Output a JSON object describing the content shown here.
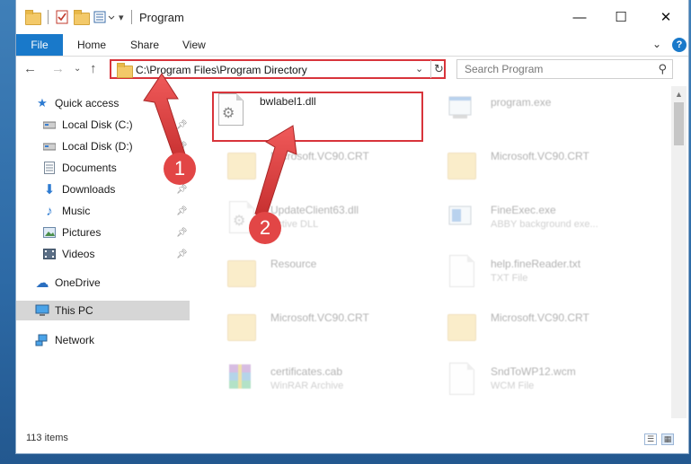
{
  "window": {
    "title": "Program",
    "minimize_glyph": "—",
    "maximize_glyph": "☐",
    "close_glyph": "✕"
  },
  "ribbon": {
    "tabs": [
      "File",
      "Home",
      "Share",
      "View"
    ],
    "help_glyph": "?",
    "expand_glyph": "⌄"
  },
  "address": {
    "path": "C:\\Program Files\\Program Directory",
    "search_placeholder": "Search Program"
  },
  "nav_pane": {
    "items": [
      {
        "label": "Quick access",
        "icon": "star-icon",
        "pinned": false
      },
      {
        "label": "Local Disk (C:)",
        "icon": "drive-icon",
        "pinned": true
      },
      {
        "label": "Local Disk (D:)",
        "icon": "drive-icon",
        "pinned": true
      },
      {
        "label": "Documents",
        "icon": "documents-icon",
        "pinned": true
      },
      {
        "label": "Downloads",
        "icon": "download-icon",
        "pinned": true
      },
      {
        "label": "Music",
        "icon": "music-icon",
        "pinned": true
      },
      {
        "label": "Pictures",
        "icon": "pictures-icon",
        "pinned": true
      },
      {
        "label": "Videos",
        "icon": "videos-icon",
        "pinned": true
      },
      {
        "label": "OneDrive",
        "icon": "cloud-icon",
        "pinned": false
      },
      {
        "label": "This PC",
        "icon": "computer-icon",
        "pinned": false,
        "selected": true
      },
      {
        "label": "Network",
        "icon": "network-icon",
        "pinned": false
      }
    ]
  },
  "files": [
    {
      "name": "bwlabel1.dll",
      "type": "",
      "icon": "dll-gear-icon",
      "highlighted": true
    },
    {
      "name": "program.exe",
      "type": "",
      "icon": "exe-icon"
    },
    {
      "name": "Microsoft.VC90.CRT",
      "type": "",
      "icon": "folder-icon"
    },
    {
      "name": "Microsoft.VC90.CRT",
      "type": "",
      "icon": "folder-icon"
    },
    {
      "name": "UpdateClient63.dll",
      "type": "Active DLL",
      "icon": "dll-gear-icon"
    },
    {
      "name": "FineExec.exe",
      "type": "ABBY background exe...",
      "icon": "exe-icon"
    },
    {
      "name": "Resource",
      "type": "",
      "icon": "folder-icon"
    },
    {
      "name": "help.fineReader.txt",
      "type": "TXT File",
      "icon": "text-file-icon"
    },
    {
      "name": "Microsoft.VC90.CRT",
      "type": "",
      "icon": "folder-icon"
    },
    {
      "name": "Microsoft.VC90.CRT",
      "type": "",
      "icon": "folder-icon"
    },
    {
      "name": "certificates.cab",
      "type": "WinRAR Archive",
      "icon": "archive-icon"
    },
    {
      "name": "SndToWP12.wcm",
      "type": "WCM File",
      "icon": "text-file-icon"
    }
  ],
  "status": {
    "item_count": "113 items"
  },
  "annotations": {
    "callout_1": "1",
    "callout_2": "2",
    "color": "#e24646"
  }
}
